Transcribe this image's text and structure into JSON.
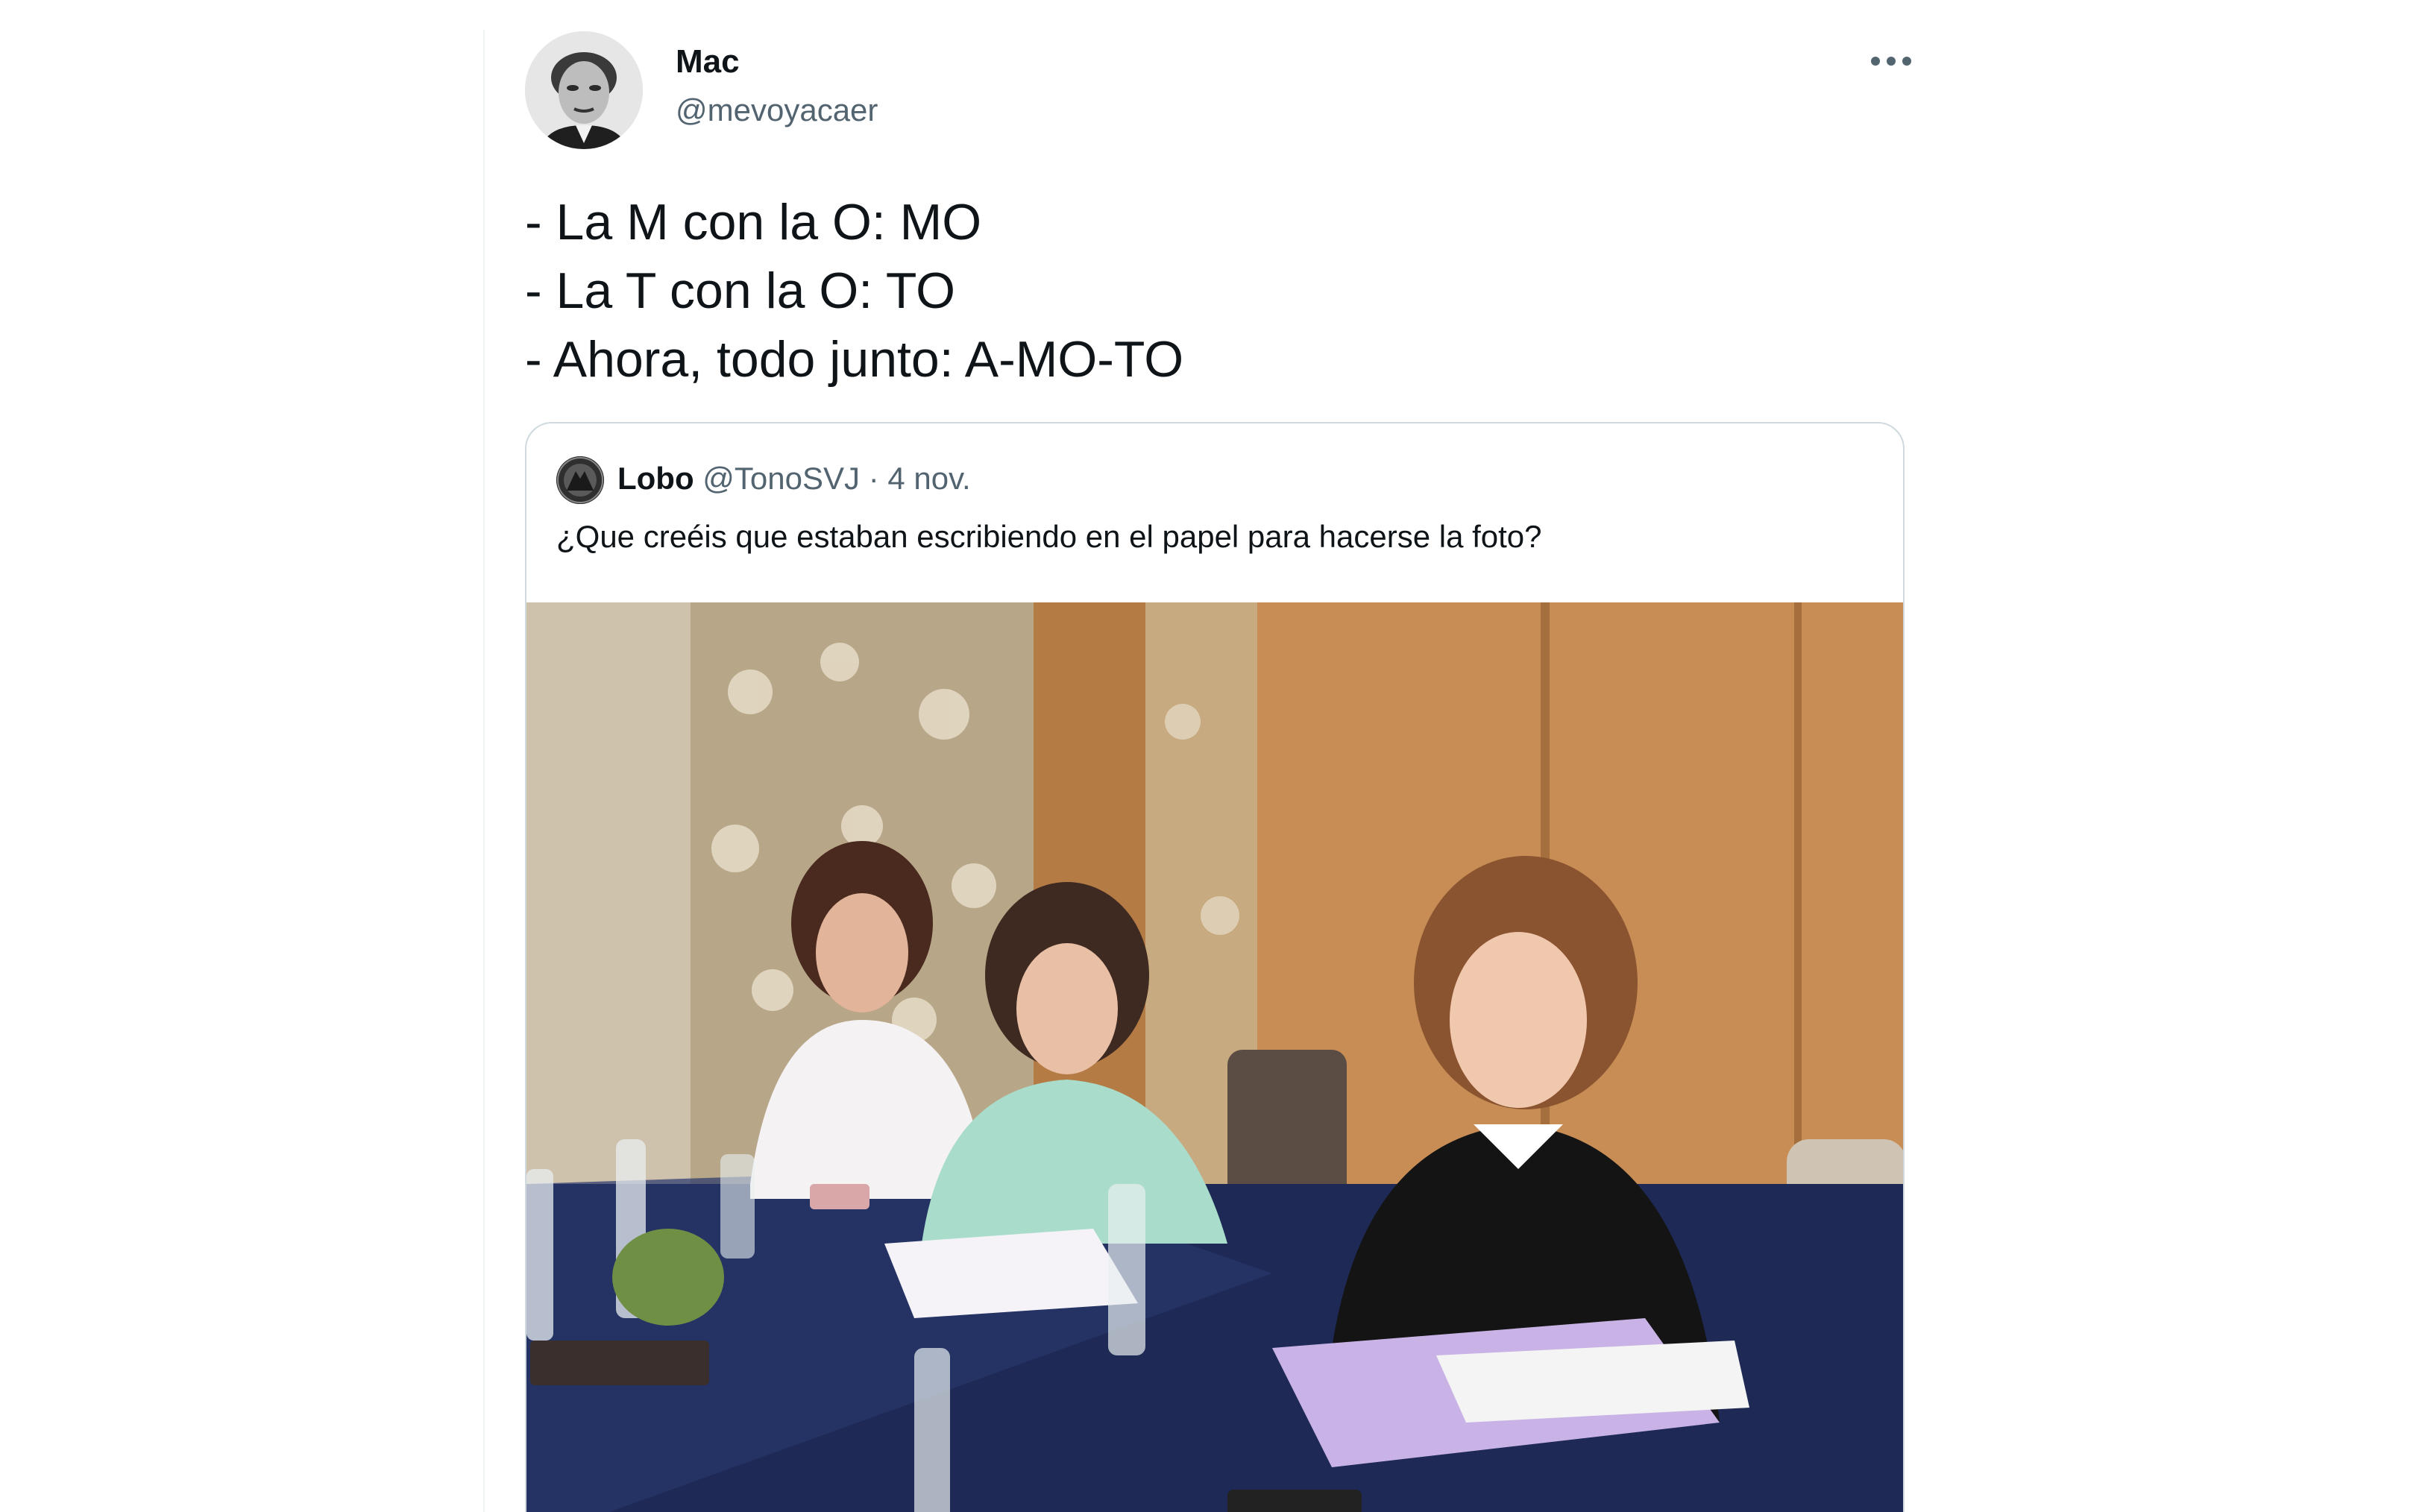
{
  "author": {
    "display_name": "Mac",
    "handle": "@mevoyacaer",
    "avatar_icon": "portrait-avatar"
  },
  "more_icon": "more-options-icon",
  "tweet": {
    "lines": [
      "- La M con la O: MO",
      "- La T con la O: TO",
      "- Ahora, todo junto: A-MO-TO"
    ]
  },
  "quote": {
    "name": "Lobo",
    "handle": "@TonoSVJ",
    "separator": "·",
    "date": "4 nov.",
    "text": "¿Que creéis que estaban escribiendo en el papel para hacerse la foto?",
    "media_icon": "photo-four-women-writing-at-table"
  },
  "colors": {
    "text_primary": "#0f1419",
    "text_secondary": "#536471",
    "border": "#cfd9de"
  }
}
